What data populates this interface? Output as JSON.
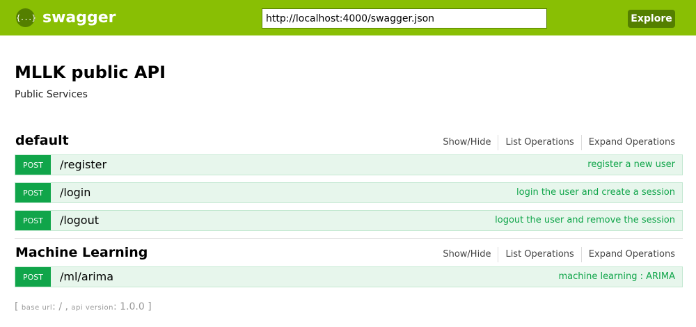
{
  "header": {
    "logo_glyph": "{...}",
    "brand": "swagger",
    "url_value": "http://localhost:4000/swagger.json",
    "explore_label": "Explore",
    "brand_color": "#89bf04"
  },
  "info": {
    "title": "MLLK public API",
    "description": "Public Services"
  },
  "groups": [
    {
      "name": "default",
      "show_hide": "Show/Hide",
      "list_operations": "List Operations",
      "expand_operations": "Expand Operations",
      "operations": [
        {
          "method": "POST",
          "path": "/register",
          "summary": "register a new user"
        },
        {
          "method": "POST",
          "path": "/login",
          "summary": "login the user and create a session"
        },
        {
          "method": "POST",
          "path": "/logout",
          "summary": "logout the user and remove the session"
        }
      ]
    },
    {
      "name": "Machine Learning",
      "show_hide": "Show/Hide",
      "list_operations": "List Operations",
      "expand_operations": "Expand Operations",
      "operations": [
        {
          "method": "POST",
          "path": "/ml/arima",
          "summary": "machine learning : ARIMA"
        }
      ]
    }
  ],
  "footer": {
    "open": "[",
    "base_url_label": "base url",
    "base_url_value": "/",
    "api_version_label": "api version",
    "api_version_value": "1.0.0",
    "close": "]"
  }
}
